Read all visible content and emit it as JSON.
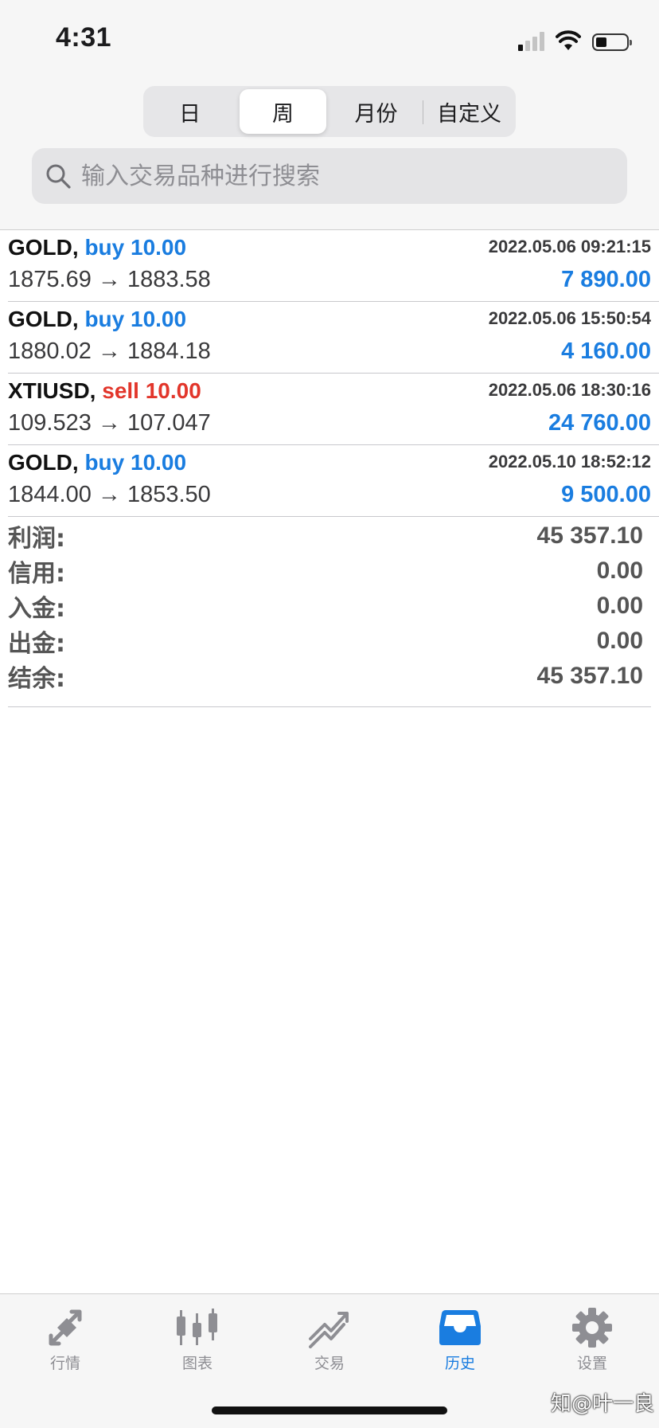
{
  "status_bar": {
    "time": "4:31"
  },
  "period_tabs": [
    {
      "label": "日",
      "active": false
    },
    {
      "label": "周",
      "active": true
    },
    {
      "label": "月份",
      "active": false
    },
    {
      "label": "自定义",
      "active": false
    }
  ],
  "search": {
    "placeholder": "输入交易品种进行搜索"
  },
  "deals": [
    {
      "symbol": "GOLD,",
      "direction": "buy 10.00",
      "type": "buy",
      "datetime": "2022.05.06 09:21:15",
      "prices": "1875.69 → 1883.58",
      "profit": "7 890.00"
    },
    {
      "symbol": "GOLD,",
      "direction": "buy 10.00",
      "type": "buy",
      "datetime": "2022.05.06 15:50:54",
      "prices": "1880.02 → 1884.18",
      "profit": "4 160.00"
    },
    {
      "symbol": "XTIUSD,",
      "direction": "sell 10.00",
      "type": "sell",
      "datetime": "2022.05.06 18:30:16",
      "prices": "109.523 → 107.047",
      "profit": "24 760.00"
    },
    {
      "symbol": "GOLD,",
      "direction": "buy 10.00",
      "type": "buy",
      "datetime": "2022.05.10 18:52:12",
      "prices": "1844.00 → 1853.50",
      "profit": "9 500.00"
    }
  ],
  "summary": [
    {
      "label": "利润:",
      "value": "45 357.10"
    },
    {
      "label": "信用:",
      "value": "0.00"
    },
    {
      "label": "入金:",
      "value": "0.00"
    },
    {
      "label": "出金:",
      "value": "0.00"
    },
    {
      "label": "结余:",
      "value": "45 357.10"
    }
  ],
  "tabbar": [
    {
      "label": "行情",
      "icon": "quotes-arrows-icon",
      "active": false
    },
    {
      "label": "图表",
      "icon": "candlestick-chart-icon",
      "active": false
    },
    {
      "label": "交易",
      "icon": "trade-trend-icon",
      "active": false
    },
    {
      "label": "历史",
      "icon": "history-inbox-icon",
      "active": true
    },
    {
      "label": "设置",
      "icon": "gear-icon",
      "active": false
    }
  ],
  "watermark": "知@叶一良",
  "colors": {
    "accent": "#1a7de0",
    "sell": "#e2362b"
  }
}
